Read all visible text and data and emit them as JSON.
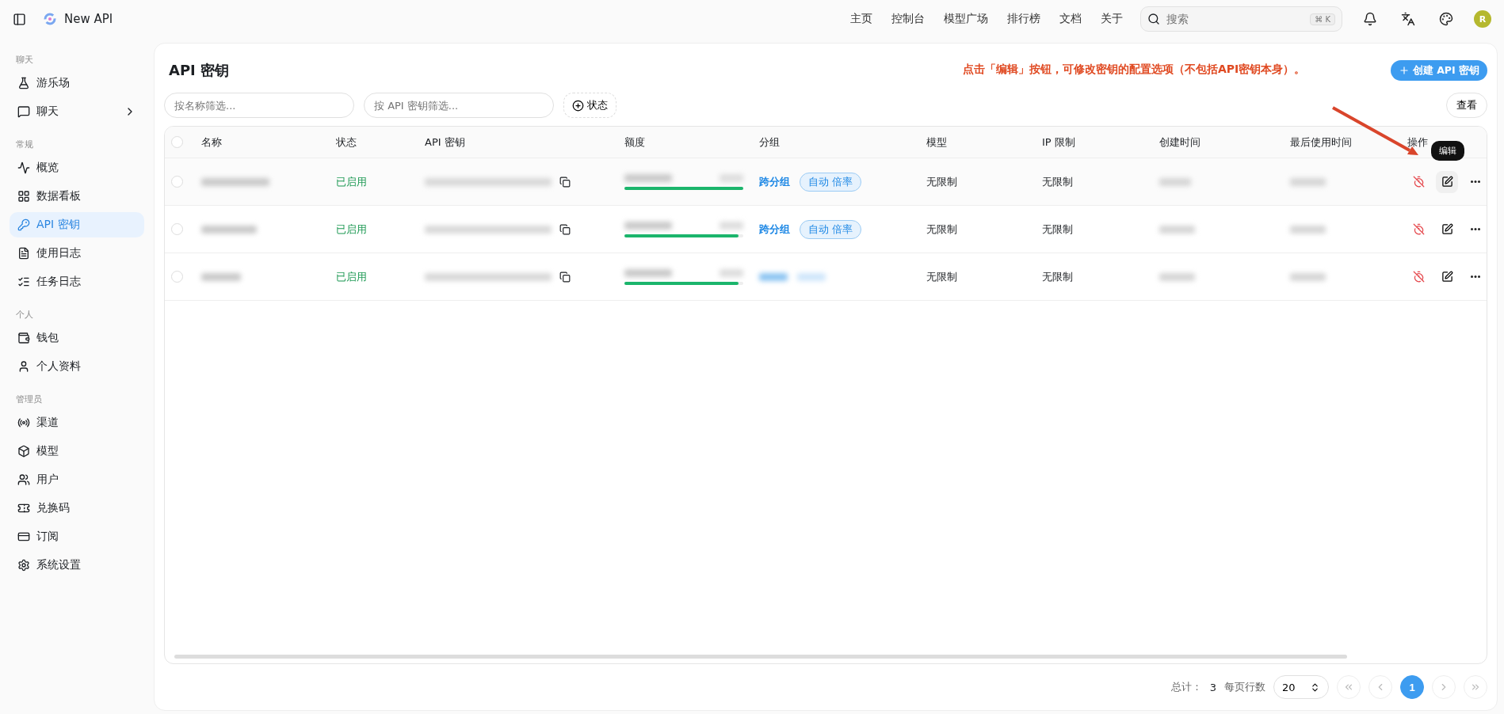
{
  "header": {
    "app_name": "New API",
    "nav": [
      "主页",
      "控制台",
      "模型广场",
      "排行榜",
      "文档",
      "关于"
    ],
    "search": {
      "placeholder": "搜索",
      "shortcut_symbol": "⌘",
      "shortcut_key": "K"
    },
    "avatar": "R"
  },
  "sidebar": {
    "sections": [
      {
        "title": "聊天",
        "items": [
          {
            "label": "游乐场",
            "selected": false,
            "expandable": false
          },
          {
            "label": "聊天",
            "selected": false,
            "expandable": true
          }
        ]
      },
      {
        "title": "常规",
        "items": [
          {
            "label": "概览",
            "selected": false,
            "expandable": false
          },
          {
            "label": "数据看板",
            "selected": false,
            "expandable": false
          },
          {
            "label": "API 密钥",
            "selected": true,
            "expandable": false
          },
          {
            "label": "使用日志",
            "selected": false,
            "expandable": false
          },
          {
            "label": "任务日志",
            "selected": false,
            "expandable": false
          }
        ]
      },
      {
        "title": "个人",
        "items": [
          {
            "label": "钱包",
            "selected": false,
            "expandable": false
          },
          {
            "label": "个人资料",
            "selected": false,
            "expandable": false
          }
        ]
      },
      {
        "title": "管理员",
        "items": [
          {
            "label": "渠道",
            "selected": false,
            "expandable": false
          },
          {
            "label": "模型",
            "selected": false,
            "expandable": false
          },
          {
            "label": "用户",
            "selected": false,
            "expandable": false
          },
          {
            "label": "兑换码",
            "selected": false,
            "expandable": false
          },
          {
            "label": "订阅",
            "selected": false,
            "expandable": false
          },
          {
            "label": "系统设置",
            "selected": false,
            "expandable": false
          }
        ]
      }
    ]
  },
  "page": {
    "title": "API 密钥",
    "create_button": "创建 API 密钥",
    "annotation": "点击「编辑」按钮，可修改密钥的配置选项（不包括API密钥本身）。",
    "filters": {
      "name_placeholder": "按名称筛选...",
      "key_placeholder": "按 API 密钥筛选...",
      "status_button": "状态"
    },
    "view_button": "查看"
  },
  "table": {
    "all_selected": false,
    "columns": [
      "名称",
      "状态",
      "API 密钥",
      "额度",
      "分组",
      "模型",
      "IP 限制",
      "创建时间",
      "最后使用时间",
      "操作"
    ],
    "rows": [
      {
        "selected": false,
        "status": "已启用",
        "level": 1.0,
        "group": {
          "kind": "text",
          "label": "跨分组",
          "tag": "自动 倍率"
        },
        "model": "无限制",
        "ip_limit": "无限制",
        "tooltip": "编辑"
      },
      {
        "selected": false,
        "status": "已启用",
        "level": 0.96,
        "group": {
          "kind": "text",
          "label": "跨分组",
          "tag": "自动 倍率"
        },
        "model": "无限制",
        "ip_limit": "无限制"
      },
      {
        "selected": false,
        "status": "已启用",
        "level": 0.96,
        "group": {
          "kind": "redacted"
        },
        "model": "无限制",
        "ip_limit": "无限制"
      }
    ]
  },
  "pagination": {
    "total_label": "总计：",
    "total": "3",
    "rows_label": "每页行数",
    "page_size": "20",
    "pages": [
      {
        "label": "1",
        "selected": true
      }
    ]
  }
}
